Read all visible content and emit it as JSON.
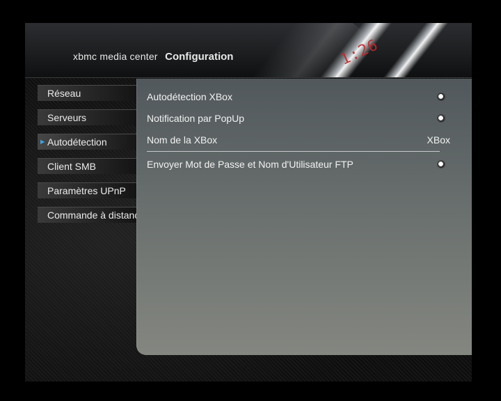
{
  "header": {
    "app_name": "xbmc media center",
    "title": "Configuration",
    "clock": "1:26"
  },
  "sidebar": {
    "items": [
      {
        "label": "Réseau"
      },
      {
        "label": "Serveurs"
      },
      {
        "label": "Autodétection",
        "active": true
      },
      {
        "label": "Client SMB"
      },
      {
        "label": "Paramètres UPnP"
      },
      {
        "label": "Commande à distance"
      }
    ]
  },
  "settings": {
    "items": [
      {
        "label": "Autodétection XBox",
        "type": "radio",
        "checked": true
      },
      {
        "label": "Notification par PopUp",
        "type": "radio",
        "checked": true
      },
      {
        "label": "Nom de la XBox",
        "type": "text",
        "value": "XBox"
      },
      {
        "label": "Envoyer Mot de Passe et Nom d'Utilisateur FTP",
        "type": "radio",
        "checked": true
      }
    ]
  },
  "colors": {
    "accent": "#3aa7e8",
    "clock": "#c0282e"
  }
}
